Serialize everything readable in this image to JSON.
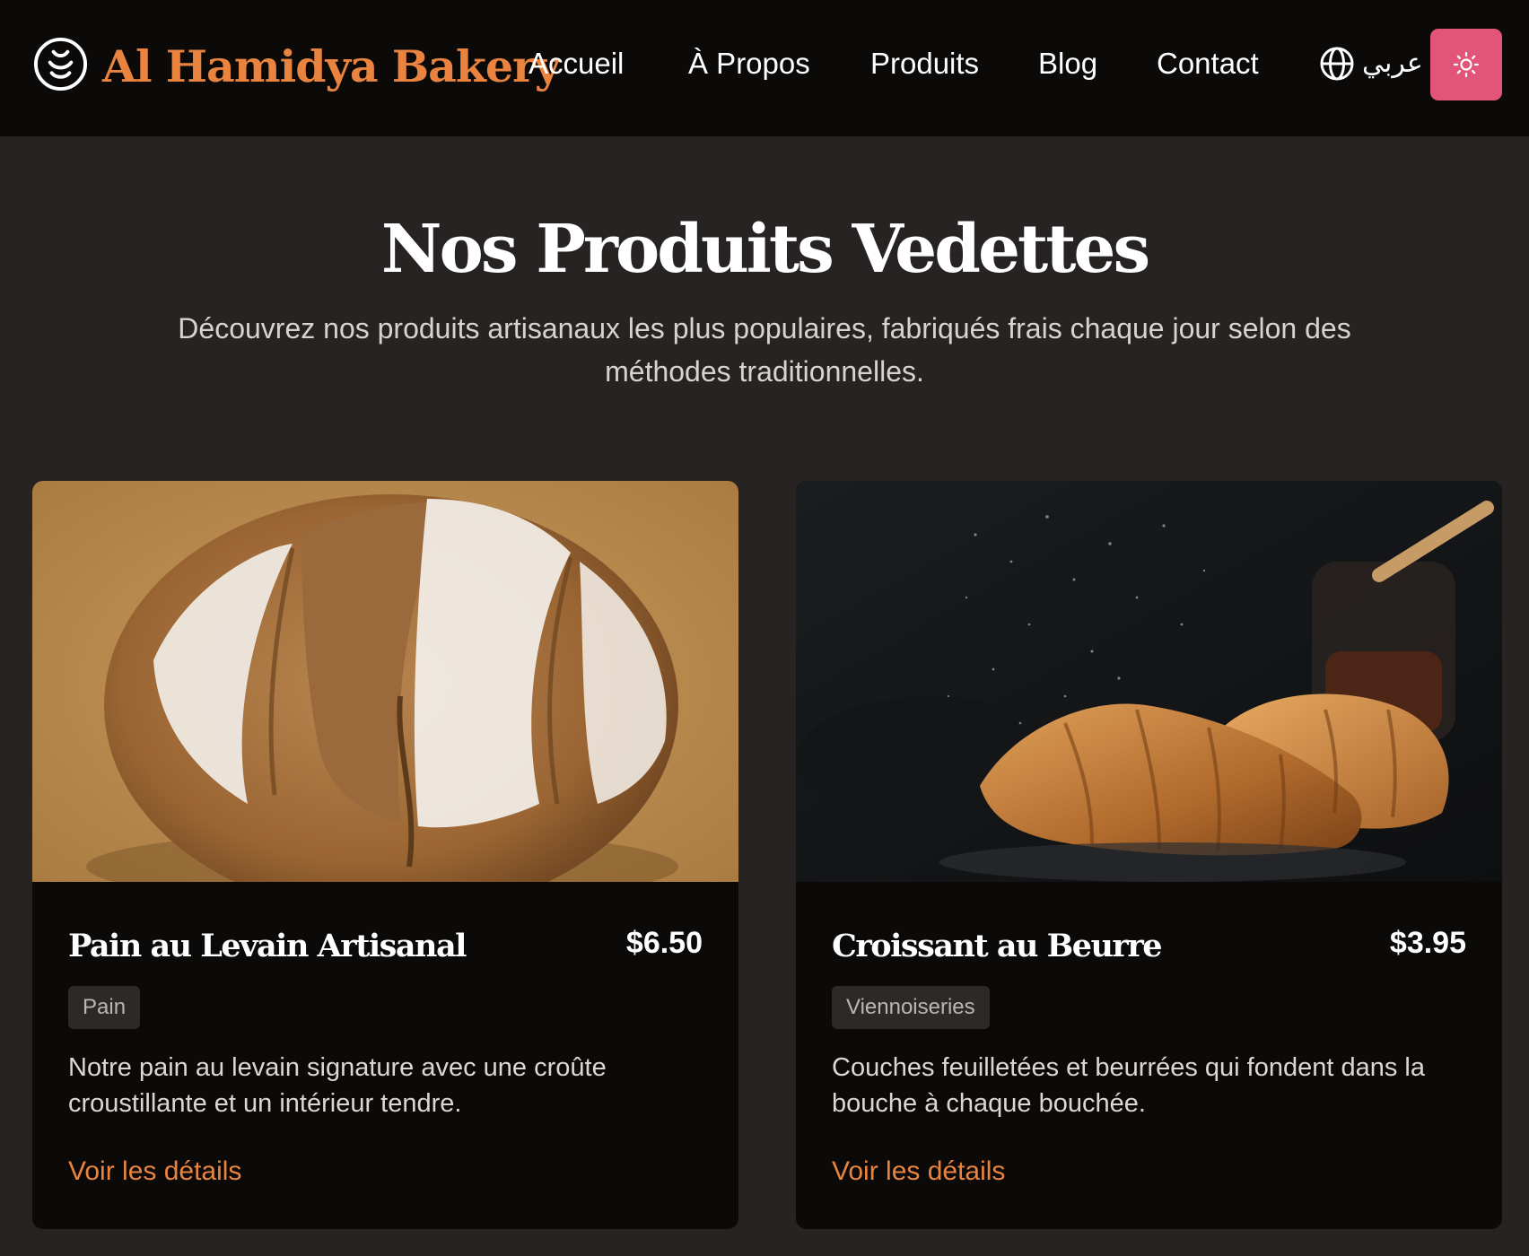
{
  "header": {
    "logo_icon": "bakery-swirl-icon",
    "brand_name": "Al Hamidya Bakery",
    "brand_color": "#e8843f",
    "nav": [
      {
        "label": "Accueil"
      },
      {
        "label": "À Propos"
      },
      {
        "label": "Produits"
      },
      {
        "label": "Blog"
      },
      {
        "label": "Contact"
      }
    ],
    "language": {
      "icon": "globe-icon",
      "label": "عربي"
    },
    "theme_toggle": {
      "icon": "sun-icon",
      "color": "#e1557a"
    }
  },
  "featured": {
    "title": "Nos Produits Vedettes",
    "subtitle": "Découvrez nos produits artisanaux les plus populaires, fabriqués frais chaque jour selon des méthodes traditionnelles.",
    "products": [
      {
        "name": "Pain au Levain Artisanal",
        "price": "$6.50",
        "category": "Pain",
        "description": "Notre pain au levain signature avec une croûte croustillante et un intérieur tendre.",
        "link": "Voir les détails",
        "image": "sourdough-loaf-photo"
      },
      {
        "name": "Croissant au Beurre",
        "price": "$3.95",
        "category": "Viennoiseries",
        "description": "Couches feuilletées et beurrées qui fondent dans la bouche à chaque bouchée.",
        "link": "Voir les détails",
        "image": "croissant-photo"
      }
    ]
  }
}
